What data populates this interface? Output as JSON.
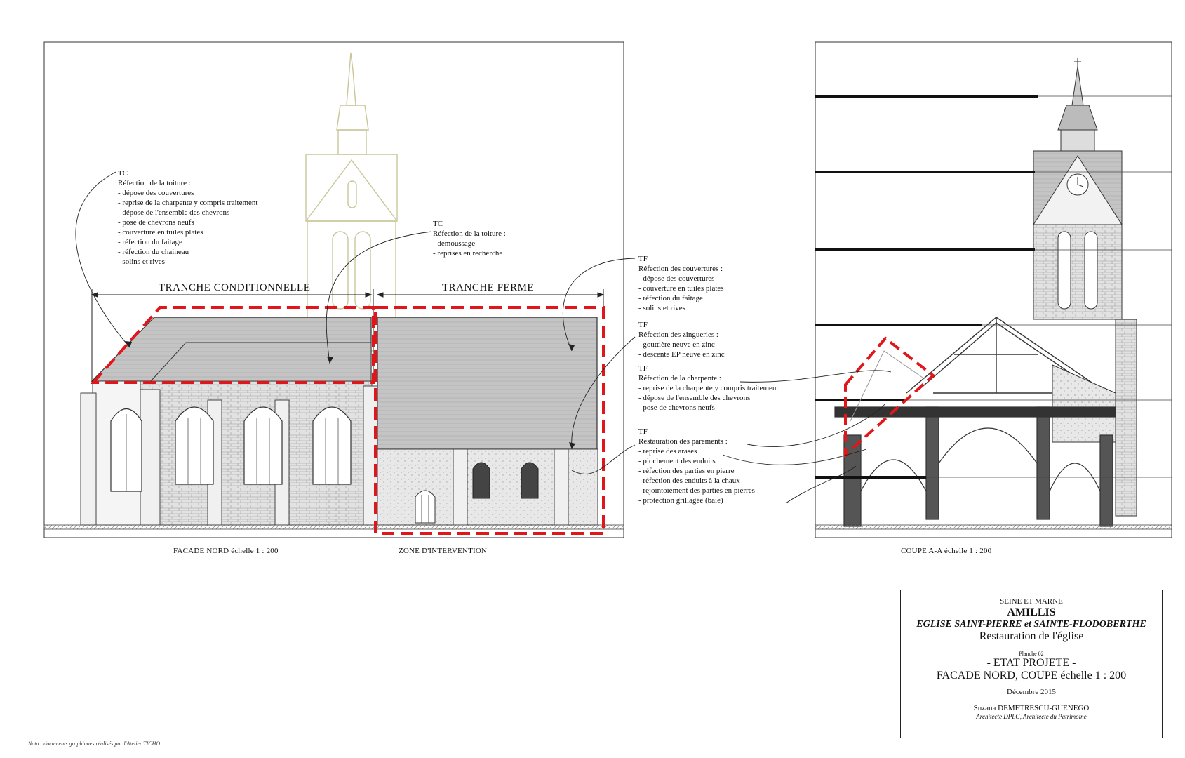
{
  "drawings": {
    "facade": {
      "caption": "FACADE NORD échelle 1 : 200",
      "zone_caption": "ZONE D'INTERVENTION",
      "band_tc": "TRANCHE CONDITIONNELLE",
      "band_tf": "TRANCHE FERME"
    },
    "section": {
      "caption": "COUPE A-A échelle 1 : 200"
    }
  },
  "annotations": [
    {
      "code": "TC",
      "title": "Réfection de la toiture :",
      "items": [
        "- dépose des couvertures",
        "- reprise de la charpente y compris traitement",
        "- dépose de l'ensemble des chevrons",
        "- pose de chevrons neufs",
        "- couverture en tuiles plates",
        "- réfection du faitage",
        "- réfection du chaineau",
        "- solins et rives"
      ]
    },
    {
      "code": "TC",
      "title": "Réfection de la toiture :",
      "items": [
        "- démoussage",
        "- reprises en recherche"
      ]
    },
    {
      "code": "TF",
      "title": "Réfection des couvertures :",
      "items": [
        "- dépose des couvertures",
        "- couverture en tuiles plates",
        "- réfection du faitage",
        "- solins et rives"
      ]
    },
    {
      "code": "TF",
      "title": "Réfection des zingueries :",
      "items": [
        "- gouttière neuve en zinc",
        "- descente EP neuve en zinc"
      ]
    },
    {
      "code": "TF",
      "title": "Réfection de la charpente :",
      "items": [
        "- reprise de la charpente y compris traitement",
        "- dépose de l'ensemble des chevrons",
        "- pose de chevrons neufs"
      ]
    },
    {
      "code": "TF",
      "title": "Restauration des parements :",
      "items": [
        "- reprise des arases",
        "- piochement des enduits",
        "- réfection des parties en pierre",
        "- réfection des enduits à la chaux",
        "- rejointoiement des parties en pierres",
        "- protection grillagée (baie)"
      ]
    }
  ],
  "titleblock": {
    "department": "SEINE ET MARNE",
    "town": "AMILLIS",
    "church": "EGLISE SAINT-PIERRE et SAINTE-FLODOBERTHE",
    "project": "Restauration de l'église",
    "sheet": "Planche 02",
    "state": "- ETAT PROJETE -",
    "subject": "FACADE NORD, COUPE  échelle 1 : 200",
    "date": "Décembre 2015",
    "architect": "Suzana DEMETRESCU-GUENEGO",
    "architect_title": "Architecte DPLG, Architecte du Patrimoine"
  },
  "footnote": "Nota : documents graphiques réalisés par l'Atelier TICHO",
  "colors": {
    "intervention_zone": "#e0161b",
    "ghost_tower": "#c9c79a",
    "stone": "#d8d8d8",
    "roof": "#bdbdbd"
  }
}
